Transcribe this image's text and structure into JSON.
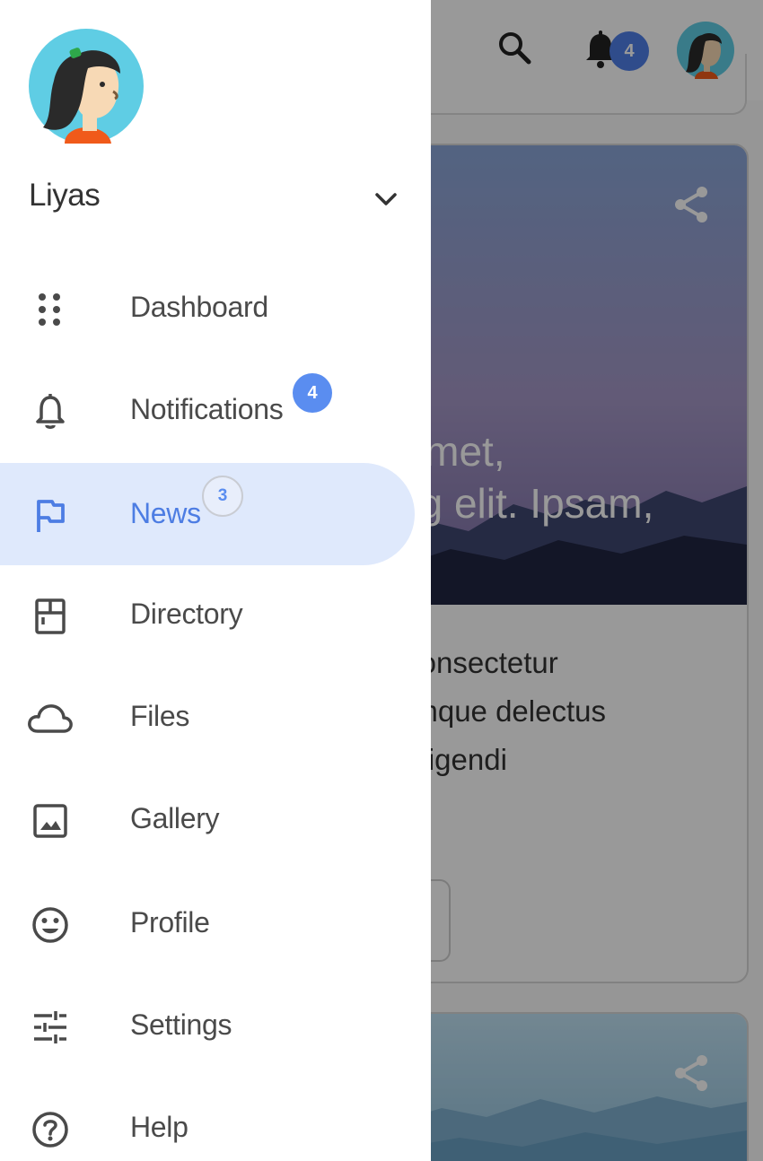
{
  "app": {
    "notification_count": "4",
    "card1": {
      "title": "t amet,\nng elit. Ipsam,",
      "body": " consectetur\numque delectus\n eligendi"
    }
  },
  "drawer": {
    "user": {
      "name": "Liyas"
    },
    "items": [
      {
        "label": "Dashboard",
        "icon": "dashboard-dots-icon"
      },
      {
        "label": "Notifications",
        "icon": "bell-icon",
        "badge": "4"
      },
      {
        "label": "News",
        "icon": "flag-icon",
        "badge": "3",
        "active": true
      },
      {
        "label": "Directory",
        "icon": "directory-icon"
      },
      {
        "label": "Files",
        "icon": "cloud-icon"
      },
      {
        "label": "Gallery",
        "icon": "image-icon"
      },
      {
        "label": "Profile",
        "icon": "smiley-icon"
      },
      {
        "label": "Settings",
        "icon": "tune-icon"
      },
      {
        "label": "Help",
        "icon": "help-icon"
      }
    ]
  },
  "colors": {
    "accent": "#4d7de3",
    "active_bg": "#dfe9fc",
    "badge": "#5a8df0",
    "scrim": "rgba(0,0,0,0.40)"
  }
}
